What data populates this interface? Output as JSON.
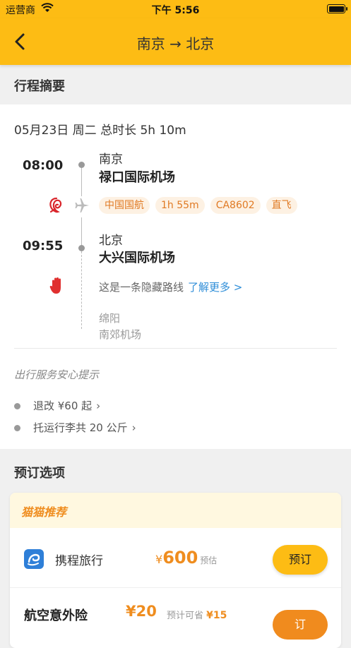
{
  "status_bar": {
    "carrier": "运营商",
    "time": "下午 5:56"
  },
  "nav": {
    "title": "南京 → 北京"
  },
  "summary": {
    "header": "行程摘要",
    "date_line": "05月23日 周二 总时长 5h 10m",
    "departure": {
      "time": "08:00",
      "city": "南京",
      "airport": "禄口国际机场"
    },
    "flight_tags": [
      "中国国航",
      "1h 55m",
      "CA8602",
      "直飞"
    ],
    "arrival": {
      "time": "09:55",
      "city": "北京",
      "airport": "大兴国际机场"
    },
    "hidden_route": {
      "text": "这是一条隐藏路线",
      "link": "了解更多 >"
    },
    "via": {
      "city": "绵阳",
      "airport": "南郊机场"
    },
    "tips_title": "出行服务安心提示",
    "tips": [
      "退改 ¥60 起",
      "托运行李共 20 公斤"
    ]
  },
  "booking": {
    "header": "预订选项",
    "recommend_label": "猫猫推荐",
    "vendor": {
      "name": "携程旅行",
      "currency": "¥",
      "price": "600",
      "price_note": "预估",
      "button": "预订"
    },
    "insurance": {
      "name": "航空意外险",
      "price": "¥20",
      "save_label": "预计可省",
      "save_amount": "¥15",
      "button": "订"
    }
  },
  "colors": {
    "brand": "#fdbc14",
    "accent": "#ef8d1f",
    "link": "#2f8ed8"
  },
  "icons": [
    "wifi-icon",
    "battery-icon",
    "back-arrow-icon",
    "airline-logo-icon",
    "plane-icon",
    "hand-stop-icon",
    "chevron-right-icon",
    "ctrip-logo-icon"
  ]
}
